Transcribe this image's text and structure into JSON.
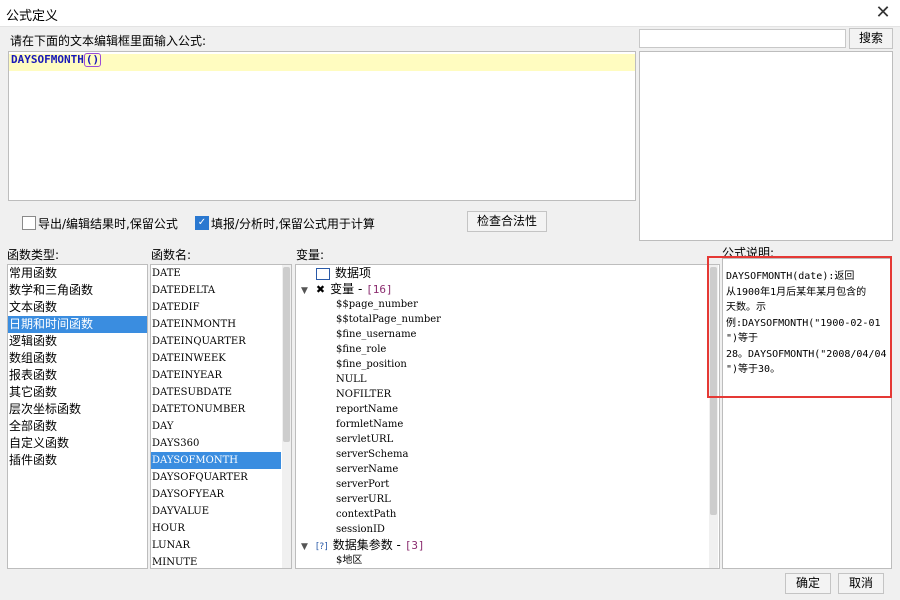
{
  "window": {
    "title": "公式定义",
    "close_glyph": "✕"
  },
  "editor": {
    "prompt": "请在下面的文本编辑框里面输入公式:",
    "formula_name": "DAYSOFMONTH",
    "formula_parens": "()"
  },
  "search": {
    "value": "",
    "button_label": "搜索"
  },
  "options": {
    "export_keep_formula": {
      "label": "导出/编辑结果时,保留公式",
      "checked": false
    },
    "fill_keep_formula": {
      "label": "填报/分析时,保留公式用于计算",
      "checked": true
    },
    "validate_button": "检查合法性"
  },
  "categories": {
    "header": "函数类型:",
    "items": [
      "常用函数",
      "数学和三角函数",
      "文本函数",
      "日期和时间函数",
      "逻辑函数",
      "数组函数",
      "报表函数",
      "其它函数",
      "层次坐标函数",
      "全部函数",
      "自定义函数",
      "插件函数"
    ],
    "selected": "日期和时间函数"
  },
  "functions": {
    "header": "函数名:",
    "items": [
      "DATE",
      "DATEDELTA",
      "DATEDIF",
      "DATEINMONTH",
      "DATEINQUARTER",
      "DATEINWEEK",
      "DATEINYEAR",
      "DATESUBDATE",
      "DATETONUMBER",
      "DAY",
      "DAYS360",
      "DAYSOFMONTH",
      "DAYSOFQUARTER",
      "DAYSOFYEAR",
      "DAYVALUE",
      "HOUR",
      "LUNAR",
      "MINUTE"
    ],
    "selected": "DAYSOFMONTH"
  },
  "variables": {
    "header": "变量:",
    "root_label": "数据项",
    "group1_label": "变量 - ",
    "group1_count": "[16]",
    "group1_items": [
      "$$page_number",
      "$$totalPage_number",
      "$fine_username",
      "$fine_role",
      "$fine_position",
      "NULL",
      "NOFILTER",
      "reportName",
      "formletName",
      "servletURL",
      "serverSchema",
      "serverName",
      "serverPort",
      "serverURL",
      "contextPath",
      "sessionID"
    ],
    "group2_label": "数据集参数 - ",
    "group2_count": "[3]",
    "group2_items": [
      "$地区"
    ]
  },
  "description": {
    "header": "公式说明:",
    "lines": [
      "DAYSOFMONTH(date):返回",
      "从1900年1月后某年某月包含的",
      "天数。示",
      "例:DAYSOFMONTH(\"1900-02-01",
      "\")等于",
      "28。DAYSOFMONTH(\"2008/04/04",
      "\")等于30。"
    ]
  },
  "footer": {
    "ok_label": "确定",
    "cancel_label": "取消"
  },
  "colors": {
    "selection": "#3a8de0",
    "highlight_line": "#fffcc0",
    "annotation_box": "#e53935",
    "formula_text": "#1818b8"
  }
}
